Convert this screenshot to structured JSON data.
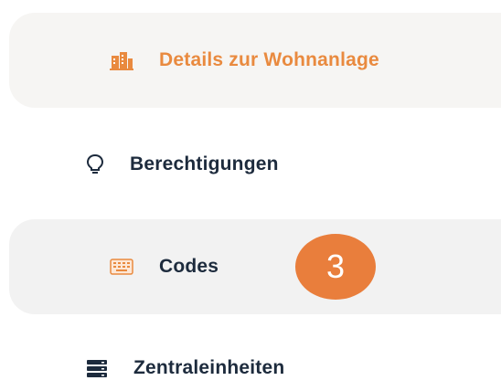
{
  "nav": {
    "items": [
      {
        "label": "Details zur Wohnanlage",
        "icon": "buildings-icon",
        "active": true
      },
      {
        "label": "Berechtigungen",
        "icon": "lightbulb-icon",
        "active": false
      },
      {
        "label": "Codes",
        "icon": "keyboard-icon",
        "active": false
      },
      {
        "label": "Zentraleinheiten",
        "icon": "server-icon",
        "active": false
      }
    ]
  },
  "badge": {
    "number": "3"
  },
  "colors": {
    "accent": "#e98a3f",
    "text": "#1d2b3d",
    "badge": "#e97e3c",
    "active_bg": "#f6f5f3",
    "codes_bg": "#f2f2f2"
  }
}
